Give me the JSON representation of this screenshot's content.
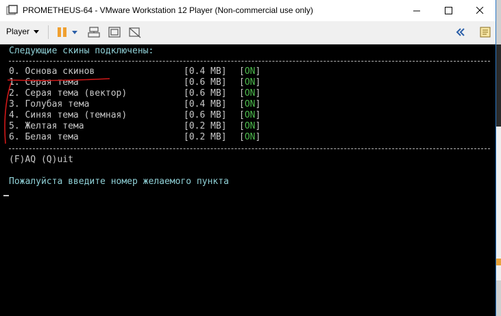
{
  "window": {
    "title": "PROMETHEUS-64 - VMware Workstation 12 Player (Non-commercial use only)"
  },
  "toolbar": {
    "player_label": "Player",
    "icons": [
      "pause-icon",
      "dropdown-icon",
      "send-ctrl-alt-del-icon",
      "fit-guest-icon",
      "unity-icon",
      "collapse-icon",
      "notes-icon"
    ]
  },
  "console": {
    "header": "Следующие скины подключены:",
    "items": [
      {
        "name": "0. Основа скинов",
        "size": "[0.4 MB]",
        "status_open": "[",
        "status": "ON",
        "status_close": "]"
      },
      {
        "name": "1. Серая тема",
        "size": "[0.6 MB]",
        "status_open": "[",
        "status": "ON",
        "status_close": "]"
      },
      {
        "name": "2. Серая тема (вектор)",
        "size": "[0.6 MB]",
        "status_open": "[",
        "status": "ON",
        "status_close": "]"
      },
      {
        "name": "3. Голубая тема",
        "size": "[0.4 MB]",
        "status_open": "[",
        "status": "ON",
        "status_close": "]"
      },
      {
        "name": "4. Синяя тема (темная)",
        "size": "[0.6 MB]",
        "status_open": "[",
        "status": "ON",
        "status_close": "]"
      },
      {
        "name": "5. Желтая тема",
        "size": "[0.2 MB]",
        "status_open": "[",
        "status": "ON",
        "status_close": "]"
      },
      {
        "name": "6. Белая тема",
        "size": "[0.2 MB]",
        "status_open": "[",
        "status": "ON",
        "status_close": "]"
      }
    ],
    "options": "(F)AQ (Q)uit",
    "prompt": "Пожалуйста введите номер желаемого пункта"
  },
  "colors": {
    "console_bg": "#000000",
    "cyan_text": "#8fd0d6",
    "green_text": "#4db84d",
    "annotation_red": "#d01818"
  }
}
